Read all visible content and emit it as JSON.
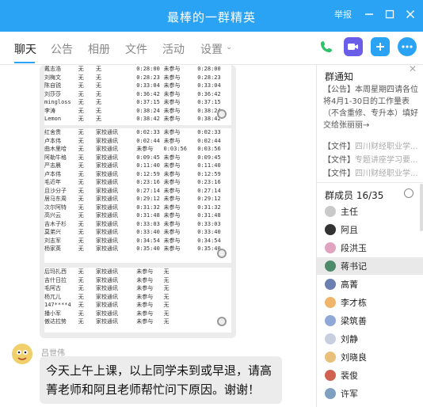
{
  "window": {
    "title": "最棒的一群精英",
    "controls": [
      "举报",
      "—",
      "□",
      "✕"
    ]
  },
  "tabs": [
    "聊天",
    "公告",
    "相册",
    "文件",
    "活动",
    "设置"
  ],
  "colors": {
    "accent": "#2aa3f4",
    "call_green": "#2ec26a",
    "video_purple": "#6a5ee8",
    "share_blue": "#2aa3f4"
  },
  "chat": {
    "attendance_table_a": [
      [
        "戴志浩",
        "无",
        "无",
        "0:28:00",
        "未参与",
        "0:28:00"
      ],
      [
        "刘梅文",
        "无",
        "无",
        "0:28:23",
        "未参与",
        "0:28:23"
      ],
      [
        "陈自锐",
        "无",
        "无",
        "0:33:04",
        "未参与",
        "0:33:04"
      ],
      [
        "刘莎莎",
        "无",
        "无",
        "0:36:42",
        "未参与",
        "0:36:42"
      ],
      [
        "mingloss",
        "无",
        "无",
        "0:37:15",
        "未参与",
        "0:37:15"
      ],
      [
        "李涛",
        "无",
        "无",
        "0:38:24",
        "未参与",
        "0:38:24"
      ],
      [
        "Lemon",
        "无",
        "无",
        "0:38:42",
        "未参与",
        "0:38:42"
      ]
    ],
    "attendance_table_b": [
      [
        "红舍贵",
        "无",
        "家校通讯",
        "0:02:33",
        "未参与",
        "0:02:33"
      ],
      [
        "卢本伟",
        "无",
        "家校通讯",
        "0:02:44",
        "未参与",
        "0:02:44"
      ],
      [
        "曲木里哈",
        "无",
        "家校通讯",
        "未参与",
        "0:03:56",
        "0:03:56"
      ],
      [
        "阿勒牛格",
        "无",
        "家校通讯",
        "0:09:45",
        "未参与",
        "0:09:45"
      ],
      [
        "严志晨",
        "无",
        "家校通讯",
        "0:11:40",
        "未参与",
        "0:11:40"
      ],
      [
        "卢本伟",
        "无",
        "家校通讯",
        "0:12:59",
        "未参与",
        "0:12:59"
      ],
      [
        "毛近年",
        "无",
        "家校通讯",
        "0:23:16",
        "未参与",
        "0:23:16"
      ],
      [
        "且沙分子",
        "无",
        "家校通讯",
        "0:27:14",
        "未参与",
        "0:27:14"
      ],
      [
        "居马东周",
        "无",
        "家校通讯",
        "0:29:12",
        "未参与",
        "0:29:12"
      ],
      [
        "次尔阿特",
        "无",
        "家校通讯",
        "0:31:32",
        "未参与",
        "0:31:32"
      ],
      [
        "高兴云",
        "无",
        "家校通讯",
        "0:31:48",
        "未参与",
        "0:31:48"
      ],
      [
        "吉木子杉",
        "无",
        "家校通讯",
        "0:33:03",
        "未参与",
        "0:33:03"
      ],
      [
        "莫弟兴",
        "无",
        "家校通讯",
        "0:33:40",
        "未参与",
        "0:33:40"
      ],
      [
        "刘志军",
        "无",
        "家校通讯",
        "0:34:54",
        "未参与",
        "0:34:54"
      ],
      [
        "杨家英",
        "无",
        "家校通讯",
        "0:35:40",
        "未参与",
        "0:35:40"
      ]
    ],
    "attendance_table_c": [
      [
        "后玛扎西",
        "无",
        "家校通讯",
        "未参与",
        "无",
        ""
      ],
      [
        "吉什日拉",
        "无",
        "家校通讯",
        "未参与",
        "无",
        ""
      ],
      [
        "毛阿古",
        "无",
        "家校通讯",
        "未参与",
        "无",
        ""
      ],
      [
        "杨兀儿",
        "无",
        "家校通讯",
        "未参与",
        "无",
        ""
      ],
      [
        "147****4",
        "无",
        "家校通讯",
        "未参与",
        "无",
        ""
      ],
      [
        "播小军",
        "无",
        "家校通讯",
        "未参与",
        "无",
        ""
      ],
      [
        "傲达拉势",
        "无",
        "家校通讯",
        "未参与",
        "无",
        ""
      ]
    ],
    "sender_name": "吕世伟",
    "message": "今天上午上课，以上同学未到或早退，请高菁老师和阿且老师帮忙问下原因。谢谢！"
  },
  "panel": {
    "notice_title": "群通知",
    "notice_text": "【公告】本周星期四请各位将4月1-30日的工作量表（不含重修、专升本）填好交给张丽丽→",
    "files": [
      {
        "label": "【文件】",
        "name": "四川财经职业学..."
      },
      {
        "label": "【文件】",
        "name": "专题讲座学习要..."
      },
      {
        "label": "【文件】",
        "name": "四川财经职业学..."
      }
    ],
    "members_title": "群成员 16/35",
    "members": [
      "主任",
      "阿且",
      "段洪玉",
      "蒋书记",
      "高菁",
      "李才栋",
      "梁筑善",
      "刘静",
      "刘晓良",
      "裴俊",
      "许军"
    ],
    "member_colors": [
      "#c9c9c9",
      "#333333",
      "#e0a3c0",
      "#4e8b6a",
      "#6b7fb0",
      "#f0b56b",
      "#8fa8d8",
      "#c8d0e0",
      "#e8c07a",
      "#d06050",
      "#7fa0c0"
    ]
  }
}
